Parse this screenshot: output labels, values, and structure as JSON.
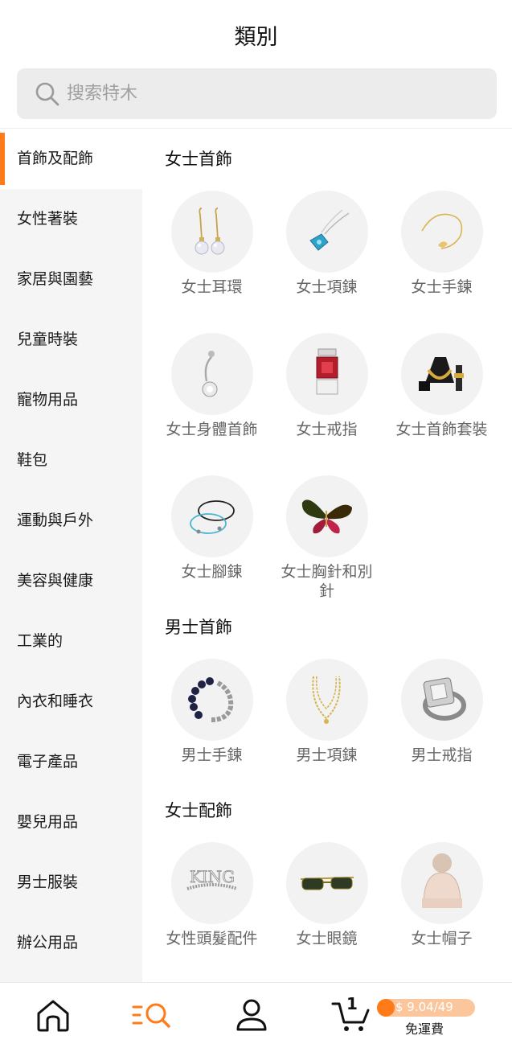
{
  "header": {
    "title": "類別"
  },
  "search": {
    "placeholder": "搜索特木"
  },
  "sidebar": {
    "items": [
      {
        "label": "首飾及配飾",
        "active": true
      },
      {
        "label": "女性著裝"
      },
      {
        "label": "家居與園藝"
      },
      {
        "label": "兒童時裝"
      },
      {
        "label": "寵物用品"
      },
      {
        "label": "鞋包"
      },
      {
        "label": "運動與戶外"
      },
      {
        "label": "美容與健康"
      },
      {
        "label": "工業的"
      },
      {
        "label": "內衣和睡衣"
      },
      {
        "label": "電子產品"
      },
      {
        "label": "嬰兒用品"
      },
      {
        "label": "男士服裝"
      },
      {
        "label": "辦公用品"
      }
    ]
  },
  "main": {
    "sections": [
      {
        "title": "女士首飾",
        "items": [
          {
            "label": "女士耳環",
            "icon": "pearl-earrings-icon"
          },
          {
            "label": "女士項鍊",
            "icon": "gem-necklace-icon"
          },
          {
            "label": "女士手鍊",
            "icon": "gold-bracelet-icon"
          },
          {
            "label": "女士身體首飾",
            "icon": "belly-ring-icon"
          },
          {
            "label": "女士戒指",
            "icon": "ring-box-icon"
          },
          {
            "label": "女士首飾套裝",
            "icon": "jewelry-set-icon"
          },
          {
            "label": "女士腳鍊",
            "icon": "anklet-icon"
          },
          {
            "label": "女士胸針和別針",
            "icon": "butterfly-brooch-icon"
          }
        ]
      },
      {
        "title": "男士首飾",
        "items": [
          {
            "label": "男士手鍊",
            "icon": "bead-bracelet-icon"
          },
          {
            "label": "男士項鍊",
            "icon": "chain-necklace-icon"
          },
          {
            "label": "男士戒指",
            "icon": "silver-ring-icon"
          }
        ]
      },
      {
        "title": "女士配飾",
        "items": [
          {
            "label": "女性頭髮配件",
            "icon": "tiara-icon",
            "logo_text": "KING"
          },
          {
            "label": "女士眼鏡",
            "icon": "sunglasses-icon"
          },
          {
            "label": "女士帽子",
            "icon": "beanie-icon"
          }
        ]
      }
    ]
  },
  "bottom_nav": {
    "items": [
      {
        "name": "home-icon"
      },
      {
        "name": "category-search-icon",
        "active": true
      },
      {
        "name": "profile-icon"
      },
      {
        "name": "cart-icon"
      }
    ],
    "cart_count": "1",
    "promo_amount": "$ 9.04/49",
    "promo_label": "免運費"
  },
  "colors": {
    "accent": "#ff7a18",
    "promo_bg": "#fbc69c",
    "sidebar_bg": "#f5f5f5",
    "thumb_bg": "#f2f2f2"
  }
}
